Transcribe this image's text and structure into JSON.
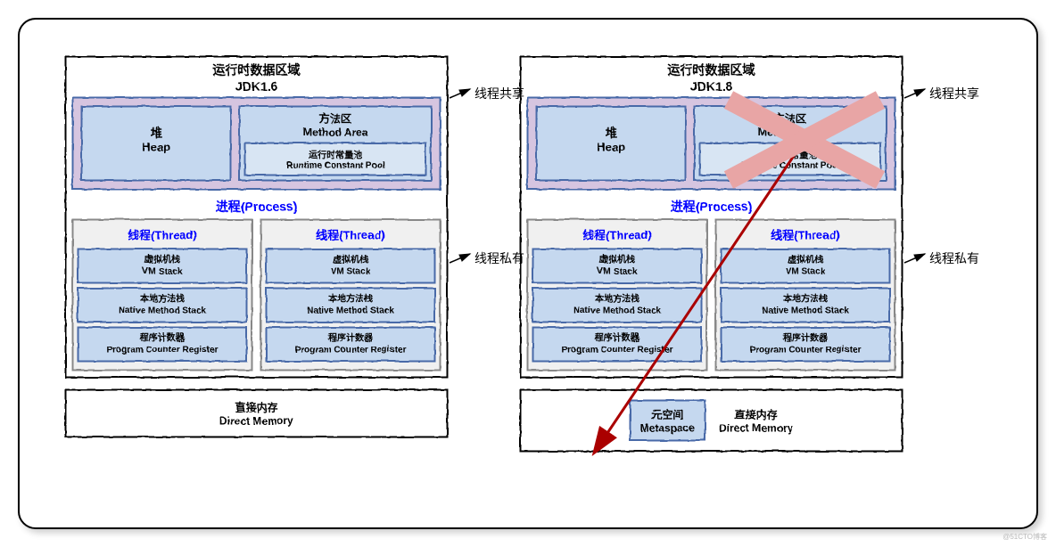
{
  "diagrams": {
    "left": {
      "title1": "运行时数据区域",
      "title2": "JDK1.6",
      "heap_cn": "堆",
      "heap_en": "Heap",
      "method_area_cn": "方法区",
      "method_area_en": "Method Area",
      "constant_pool_cn": "运行时常量池",
      "constant_pool_en": "Runtime Constant Pool",
      "process_label": "进程(Process)",
      "thread_label": "线程(Thread)",
      "vm_stack_cn": "虚拟机栈",
      "vm_stack_en": "VM Stack",
      "native_stack_cn": "本地方法栈",
      "native_stack_en": "Native Method Stack",
      "pc_cn": "程序计数器",
      "pc_en": "Program Counter Register",
      "direct_memory_cn": "直接内存",
      "direct_memory_en": "Direct Memory"
    },
    "right": {
      "title1": "运行时数据区域",
      "title2": "JDK1.8",
      "heap_cn": "堆",
      "heap_en": "Heap",
      "method_area_cn": "方法区",
      "method_area_en": "Method Area",
      "constant_pool_cn": "运行时常量池",
      "constant_pool_en": "Runtime Constant Pool",
      "process_label": "进程(Process)",
      "thread_label": "线程(Thread)",
      "vm_stack_cn": "虚拟机栈",
      "vm_stack_en": "VM Stack",
      "native_stack_cn": "本地方法栈",
      "native_stack_en": "Native Method Stack",
      "pc_cn": "程序计数器",
      "pc_en": "Program Counter Register",
      "metaspace_cn": "元空间",
      "metaspace_en": "Metaspace",
      "direct_memory_cn": "直接内存",
      "direct_memory_en": "Direct Memory"
    }
  },
  "labels": {
    "thread_shared": "线程共享",
    "thread_private": "线程私有"
  },
  "watermark": "@51CTO博客"
}
